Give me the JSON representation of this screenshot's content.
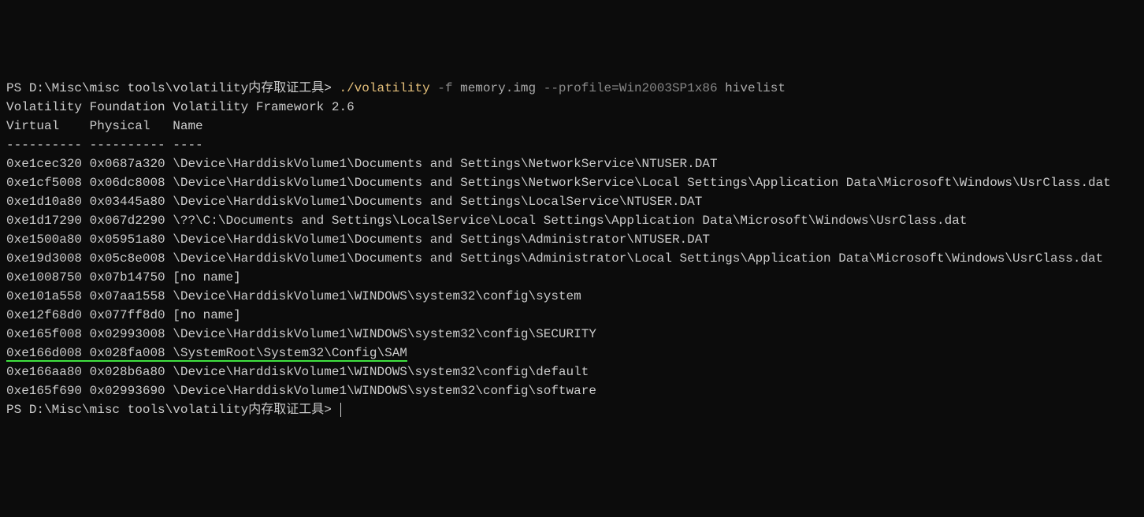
{
  "prompt1": {
    "ps": "PS ",
    "path": "D:\\Misc\\misc tools\\volatility内存取证工具",
    "sep": "> ",
    "cmd_exe": "./volatility",
    "flag_f": " -f",
    "arg_file": " memory.img",
    "flag_profile": " --profile=Win2003SP1x86",
    "arg_cmd": " hivelist"
  },
  "banner": "Volatility Foundation Volatility Framework 2.6",
  "header": {
    "virtual": "Virtual   ",
    "physical": " Physical  ",
    "name": " Name"
  },
  "divider": "---------- ---------- ----",
  "rows": [
    {
      "virt": "0xe1cec320",
      "phys": "0x0687a320",
      "name": "\\Device\\HarddiskVolume1\\Documents and Settings\\NetworkService\\NTUSER.DAT"
    },
    {
      "virt": "0xe1cf5008",
      "phys": "0x06dc8008",
      "name": "\\Device\\HarddiskVolume1\\Documents and Settings\\NetworkService\\Local Settings\\Application Data\\Microsoft\\Windows\\UsrClass.dat"
    },
    {
      "virt": "0xe1d10a80",
      "phys": "0x03445a80",
      "name": "\\Device\\HarddiskVolume1\\Documents and Settings\\LocalService\\NTUSER.DAT"
    },
    {
      "virt": "0xe1d17290",
      "phys": "0x067d2290",
      "name": "\\??\\C:\\Documents and Settings\\LocalService\\Local Settings\\Application Data\\Microsoft\\Windows\\UsrClass.dat"
    },
    {
      "virt": "0xe1500a80",
      "phys": "0x05951a80",
      "name": "\\Device\\HarddiskVolume1\\Documents and Settings\\Administrator\\NTUSER.DAT"
    },
    {
      "virt": "0xe19d3008",
      "phys": "0x05c8e008",
      "name": "\\Device\\HarddiskVolume1\\Documents and Settings\\Administrator\\Local Settings\\Application Data\\Microsoft\\Windows\\UsrClass.dat"
    },
    {
      "virt": "0xe1008750",
      "phys": "0x07b14750",
      "name": "[no name]"
    },
    {
      "virt": "0xe101a558",
      "phys": "0x07aa1558",
      "name": "\\Device\\HarddiskVolume1\\WINDOWS\\system32\\config\\system"
    },
    {
      "virt": "0xe12f68d0",
      "phys": "0x077ff8d0",
      "name": "[no name]"
    },
    {
      "virt": "0xe165f008",
      "phys": "0x02993008",
      "name": "\\Device\\HarddiskVolume1\\WINDOWS\\system32\\config\\SECURITY"
    },
    {
      "virt": "0xe166d008",
      "phys": "0x028fa008",
      "name": "\\SystemRoot\\System32\\Config\\SAM",
      "highlighted": true
    },
    {
      "virt": "0xe166aa80",
      "phys": "0x028b6a80",
      "name": "\\Device\\HarddiskVolume1\\WINDOWS\\system32\\config\\default"
    },
    {
      "virt": "0xe165f690",
      "phys": "0x02993690",
      "name": "\\Device\\HarddiskVolume1\\WINDOWS\\system32\\config\\software"
    }
  ],
  "prompt2": {
    "ps": "PS ",
    "path": "D:\\Misc\\misc tools\\volatility内存取证工具",
    "sep": "> "
  }
}
